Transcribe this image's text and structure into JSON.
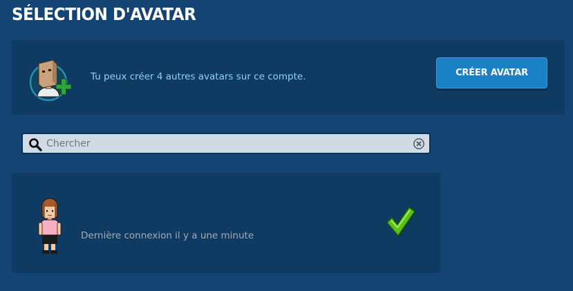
{
  "header": {
    "title": "SÉLECTION D'AVATAR"
  },
  "create_panel": {
    "info_text": "Tu peux créer 4 autres avatars sur ce compte.",
    "button_label": "CRÉER AVATAR",
    "icon": "new-avatar-icon"
  },
  "search": {
    "placeholder": "Chercher",
    "value": "",
    "icon": "search-icon",
    "clear_icon": "clear-icon"
  },
  "avatars": [
    {
      "last_login": "Dernière connexion il y a une minute",
      "selected": true,
      "status_icon": "checkmark-icon"
    }
  ],
  "colors": {
    "background": "#134474",
    "panel": "#0f3a62",
    "button": "#1a80c4",
    "info_text": "#8fd1f4",
    "check": "#58c21b"
  }
}
